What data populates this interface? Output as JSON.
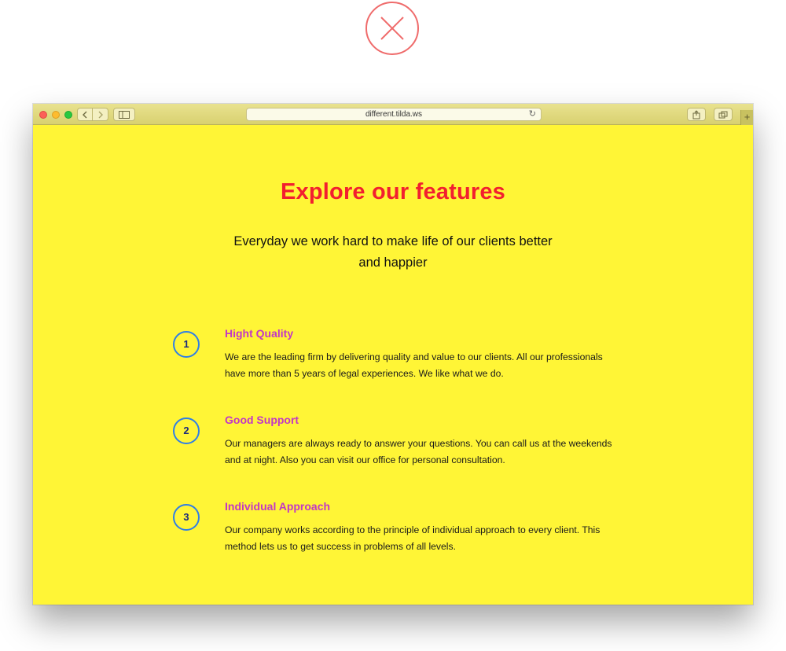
{
  "overlay": {
    "close_icon": "close-x-icon",
    "close_color": "#ef6b6b"
  },
  "browser": {
    "url": "different.tilda.ws",
    "new_tab_label": "+"
  },
  "page": {
    "background": "#fff536",
    "title": "Explore our features",
    "subtitle": "Everyday we work hard to make life of our clients better and happier",
    "features": [
      {
        "number": "1",
        "title": "Hight Quality",
        "text": "We are the leading firm by delivering quality and value to our clients. All our professionals have more than 5 years of legal experiences. We like what we do."
      },
      {
        "number": "2",
        "title": "Good Support",
        "text": "Our managers are always ready to answer your questions. You can call us at the weekends and at night. Also you can visit our office for personal consultation."
      },
      {
        "number": "3",
        "title": "Individual Approach",
        "text": "Our company works according to the principle of individual approach to every client. This method lets us to get success in problems of all levels."
      }
    ]
  }
}
